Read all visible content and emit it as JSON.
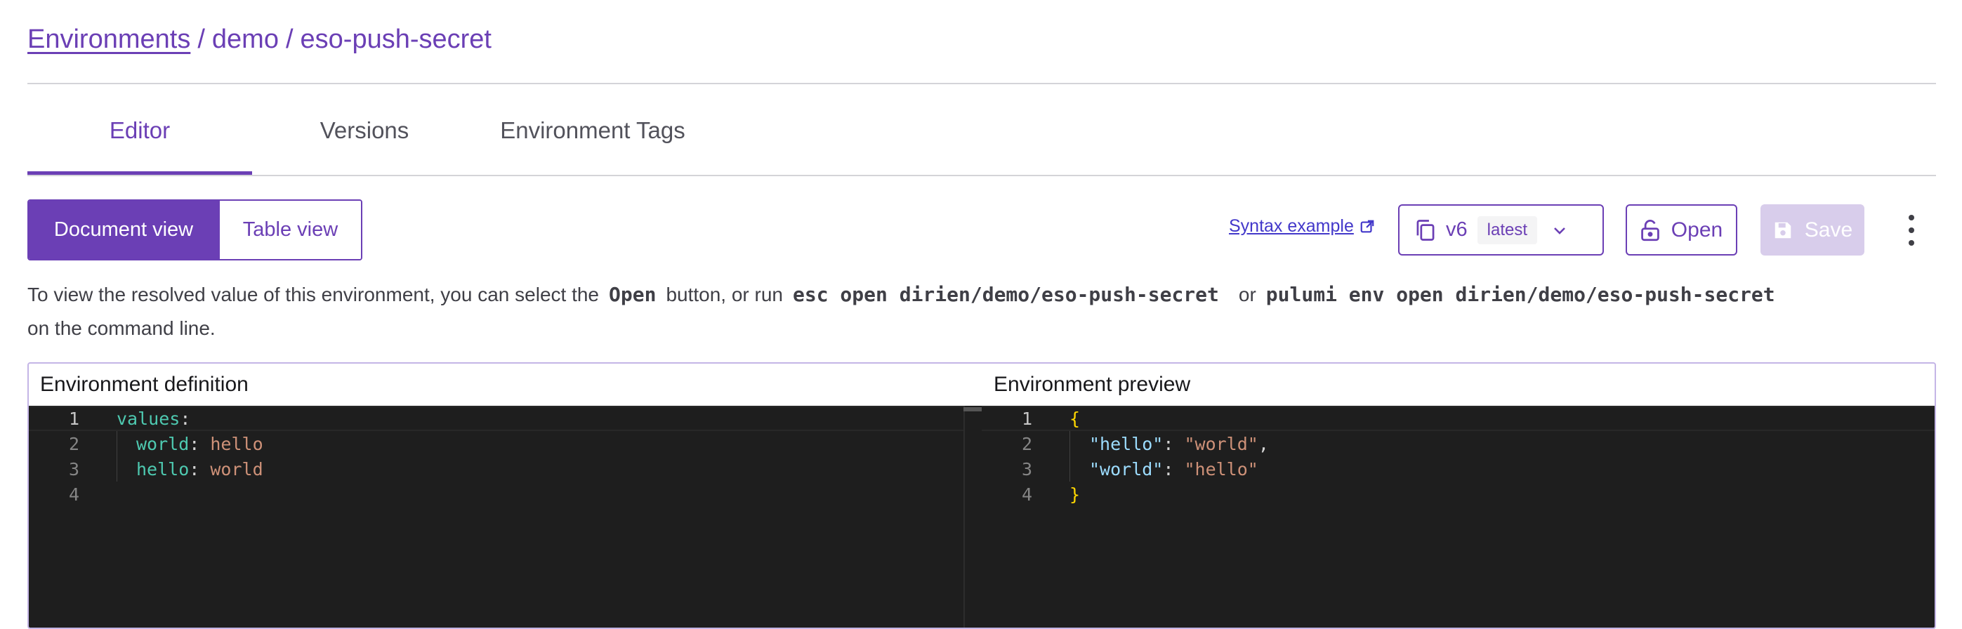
{
  "breadcrumb": {
    "root_link": "Environments",
    "separator": "/",
    "project": "demo",
    "environment": "eso-push-secret"
  },
  "tabs": {
    "editor": "Editor",
    "versions": "Versions",
    "tags": "Environment Tags",
    "active": "Editor"
  },
  "view_toggle": {
    "document": "Document view",
    "table": "Table view",
    "selected": "Document view"
  },
  "toolbar": {
    "syntax_example": "Syntax example",
    "version": "v6",
    "version_badge": "latest",
    "open_label": "Open",
    "save_label": "Save"
  },
  "info": {
    "part1": "To view the resolved value of this environment, you can select the",
    "open_keyword": "Open",
    "part2": "button, or run",
    "cmd1": "esc open dirien/demo/eso-push-secret",
    "part3": "or",
    "cmd2": "pulumi env open dirien/demo/eso-push-secret",
    "part4": "on the command line."
  },
  "definition": {
    "title": "Environment definition",
    "line_numbers": [
      "1",
      "2",
      "3",
      "4"
    ],
    "lines": [
      {
        "key": "values",
        "punct": ":",
        "value": ""
      },
      {
        "key": "world",
        "punct": ": ",
        "value": "hello"
      },
      {
        "key": "hello",
        "punct": ": ",
        "value": "world"
      }
    ]
  },
  "preview": {
    "title": "Environment preview",
    "line_numbers": [
      "1",
      "2",
      "3",
      "4"
    ],
    "open_brace": "{",
    "close_brace": "}",
    "entries": [
      {
        "key": "\"hello\"",
        "sep": ": ",
        "value": "\"world\"",
        "trail": ","
      },
      {
        "key": "\"world\"",
        "sep": ": ",
        "value": "\"hello\"",
        "trail": ""
      }
    ]
  },
  "colors": {
    "accent": "#6b3fb5",
    "save_disabled": "#d8cdeb",
    "editor_bg": "#1e1e1e",
    "yaml_key": "#4ec9b0",
    "string_value": "#ce9178",
    "json_key": "#9cdcfe",
    "bracket": "#ffd700"
  },
  "icons": {
    "external_link": "external-link-icon",
    "copy": "copy-icon",
    "chevron": "chevron-down-icon",
    "lock": "unlock-icon",
    "save": "save-icon",
    "menu": "kebab-menu-icon"
  }
}
